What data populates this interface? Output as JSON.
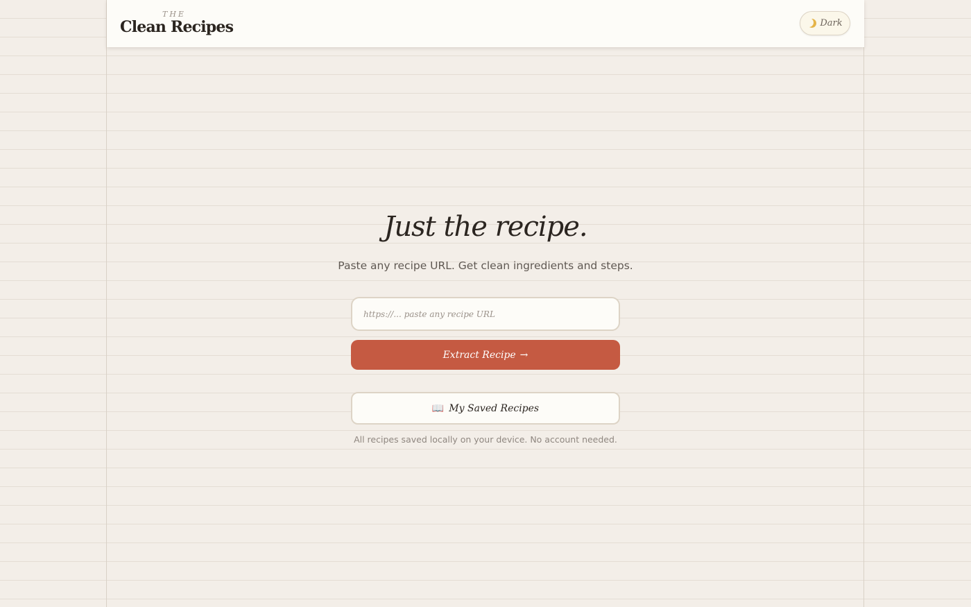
{
  "header": {
    "brand_prefix": "THE",
    "brand_name": "Clean Recipes",
    "theme_toggle": {
      "icon": "moon-icon",
      "label": "Dark"
    }
  },
  "hero": {
    "title": "Just the recipe.",
    "subtitle": "Paste any recipe URL. Get clean ingredients and steps."
  },
  "url_input": {
    "placeholder": "https://... paste any recipe URL",
    "value": ""
  },
  "extract_button": {
    "label": "Extract Recipe",
    "arrow": "→"
  },
  "saved_button": {
    "icon": "book-icon",
    "icon_glyph": "📖",
    "label": "My Saved Recipes"
  },
  "footnote": "All recipes saved locally on your device. No account needed.",
  "colors": {
    "accent": "#c55a42",
    "background": "#f3eee8",
    "surface": "#fdfcf8",
    "text": "#2b2520"
  }
}
